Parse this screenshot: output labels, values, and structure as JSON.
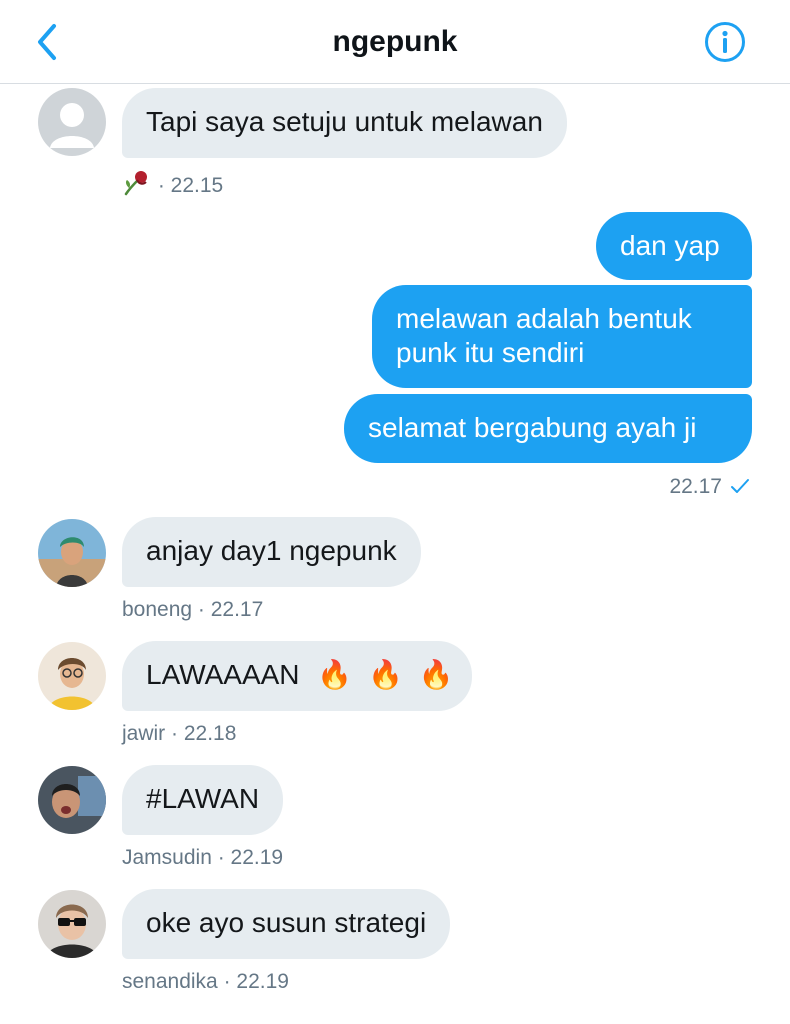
{
  "header": {
    "title": "ngepunk",
    "back_icon": "chevron-left-icon",
    "info_icon": "info-icon",
    "accent_color": "#1da1f2"
  },
  "messages": [
    {
      "text": "Tapi saya setuju untuk melawan",
      "meta_time": "· 22.15",
      "sender_icon": "wilted-rose-emoji"
    },
    {
      "text": "dan yap"
    },
    {
      "text_lines": [
        "melawan adalah bentuk",
        "punk itu sendiri"
      ]
    },
    {
      "text": "selamat bergabung ayah ji",
      "meta": "22.17",
      "status_icon": "check-icon"
    },
    {
      "text": "anjay day1 ngepunk",
      "meta": "boneng · 22.17"
    },
    {
      "text": "LAWAAAAN",
      "emoji": [
        "🔥",
        "🔥",
        "🔥"
      ],
      "meta": "jawir · 22.18"
    },
    {
      "text": "#LAWAN",
      "meta": "Jamsudin · 22.19"
    },
    {
      "text": "oke ayo susun strategi",
      "meta": "senandika · 22.19"
    }
  ],
  "colors": {
    "incoming_bubble": "#e6ecf0",
    "outgoing_bubble": "#1da1f2",
    "meta_text": "#657786"
  }
}
